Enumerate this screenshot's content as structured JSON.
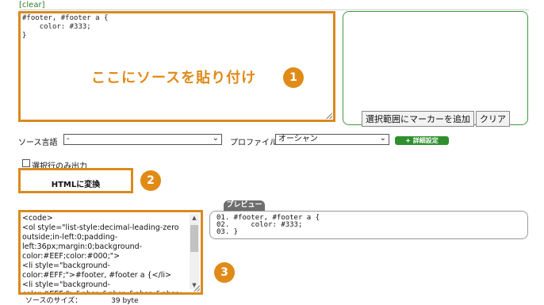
{
  "clear_link": "[clear]",
  "source": {
    "code_lines": [
      "#footer, #footer a {",
      "    color: #333;",
      "}"
    ],
    "paste_hint": "ここにソースを貼り付け",
    "badge": "1"
  },
  "marker": {
    "add_marker_label": "選択範囲にマーカーを追加",
    "clear_label": "クリア"
  },
  "options": {
    "source_lang_label": "ソース言語",
    "source_lang_value": "-",
    "profile_label": "プロファイル",
    "profile_value": "オーシャン",
    "detail_label": "+ 詳細設定",
    "selected_only_label": "選択行のみ出力"
  },
  "convert": {
    "label": "HTMLに変換",
    "badge": "2"
  },
  "preview": {
    "tab_label": "プレビュー",
    "lines": [
      "01. #footer, #footer a {",
      "02.     color: #333;",
      "03. }"
    ]
  },
  "output": {
    "lines": [
      "<code>",
      "<ol style=\"list-style:decimal-leading-zero",
      "outside;in-left:0;padding-",
      "left:36px;margin:0;background-",
      "color:#EEF;color:#000;\">",
      "<li style=\"background-",
      "color:#EFF;\">#footer, #footer a {</li>",
      "<li style=\"background-",
      "color:#EEF;\">&nbsp;&nbsp;&nbsp;&nbsp;"
    ],
    "badge": "3",
    "size_label": "ソースのサイズ：",
    "size_value": "39 byte"
  },
  "colors": {
    "accent_orange": "#e08a17",
    "green": "#3f9a3f"
  }
}
